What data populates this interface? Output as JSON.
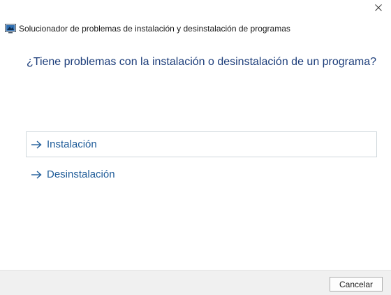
{
  "window": {
    "title": "Solucionador de problemas de instalación y desinstalación de programas",
    "close_icon": "close-icon",
    "app_icon": "troubleshooter-icon"
  },
  "main": {
    "heading": "¿Tiene problemas con la instalación o desinstalación de un programa?",
    "options": [
      {
        "label": "Instalación",
        "icon": "arrow-right-icon"
      },
      {
        "label": "Desinstalación",
        "icon": "arrow-right-icon"
      }
    ]
  },
  "footer": {
    "cancel_label": "Cancelar"
  },
  "colors": {
    "heading": "#1c3d7a",
    "link": "#1f5c99",
    "footer_bg": "#f0f0f0"
  }
}
